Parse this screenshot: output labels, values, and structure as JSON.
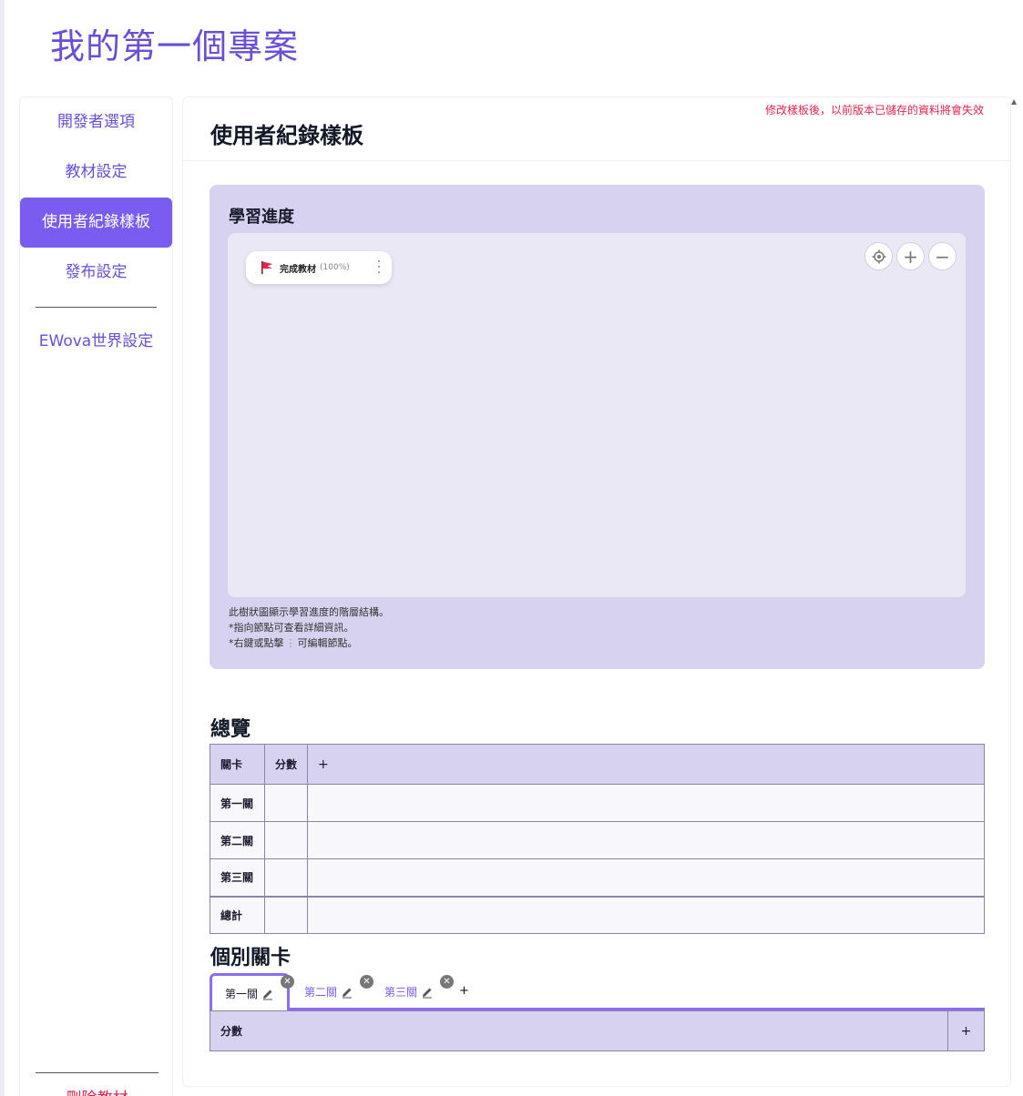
{
  "app": {
    "project_title": "我的第一個專案"
  },
  "sidebar": {
    "items": [
      {
        "label": "開發者選項"
      },
      {
        "label": "教材設定"
      },
      {
        "label": "使用者紀錄樣板",
        "active": true
      },
      {
        "label": "發布設定"
      },
      {
        "label": "EWova世界設定"
      }
    ],
    "delete_label": "刪除教材"
  },
  "main": {
    "title": "使用者紀錄樣板",
    "warning": "修改樣板後，以前版本已儲存的資料將會失效"
  },
  "progress": {
    "title": "學習進度",
    "node": {
      "label": "完成教材",
      "percent": "(100%)",
      "icon": "red-flag-icon"
    },
    "zoom_buttons": [
      "recenter-icon",
      "zoom-in-icon",
      "zoom-out-icon"
    ],
    "notes": [
      "此樹狀圖顯示學習進度的階層結構。",
      "*指向節點可查看詳細資訊。",
      "*右鍵或點擊",
      "可編輯節點。"
    ]
  },
  "overview": {
    "title": "總覽",
    "headers": [
      "關卡",
      "分數",
      "+"
    ],
    "rows": [
      "第一關",
      "第二關",
      "第三關"
    ],
    "total_label": "總計"
  },
  "levels": {
    "title": "個別關卡",
    "tabs": [
      {
        "label": "第一關",
        "active": true
      },
      {
        "label": "第二關",
        "active": false
      },
      {
        "label": "第三關",
        "active": false
      }
    ],
    "add_tab_label": "+",
    "score_label": "分數",
    "score_add_label": "+"
  },
  "colors": {
    "accent": "#7b5cf0",
    "title_purple": "#6a4fd6",
    "panel_lavender": "#d8d2f1",
    "warning_red": "#e0254f"
  }
}
